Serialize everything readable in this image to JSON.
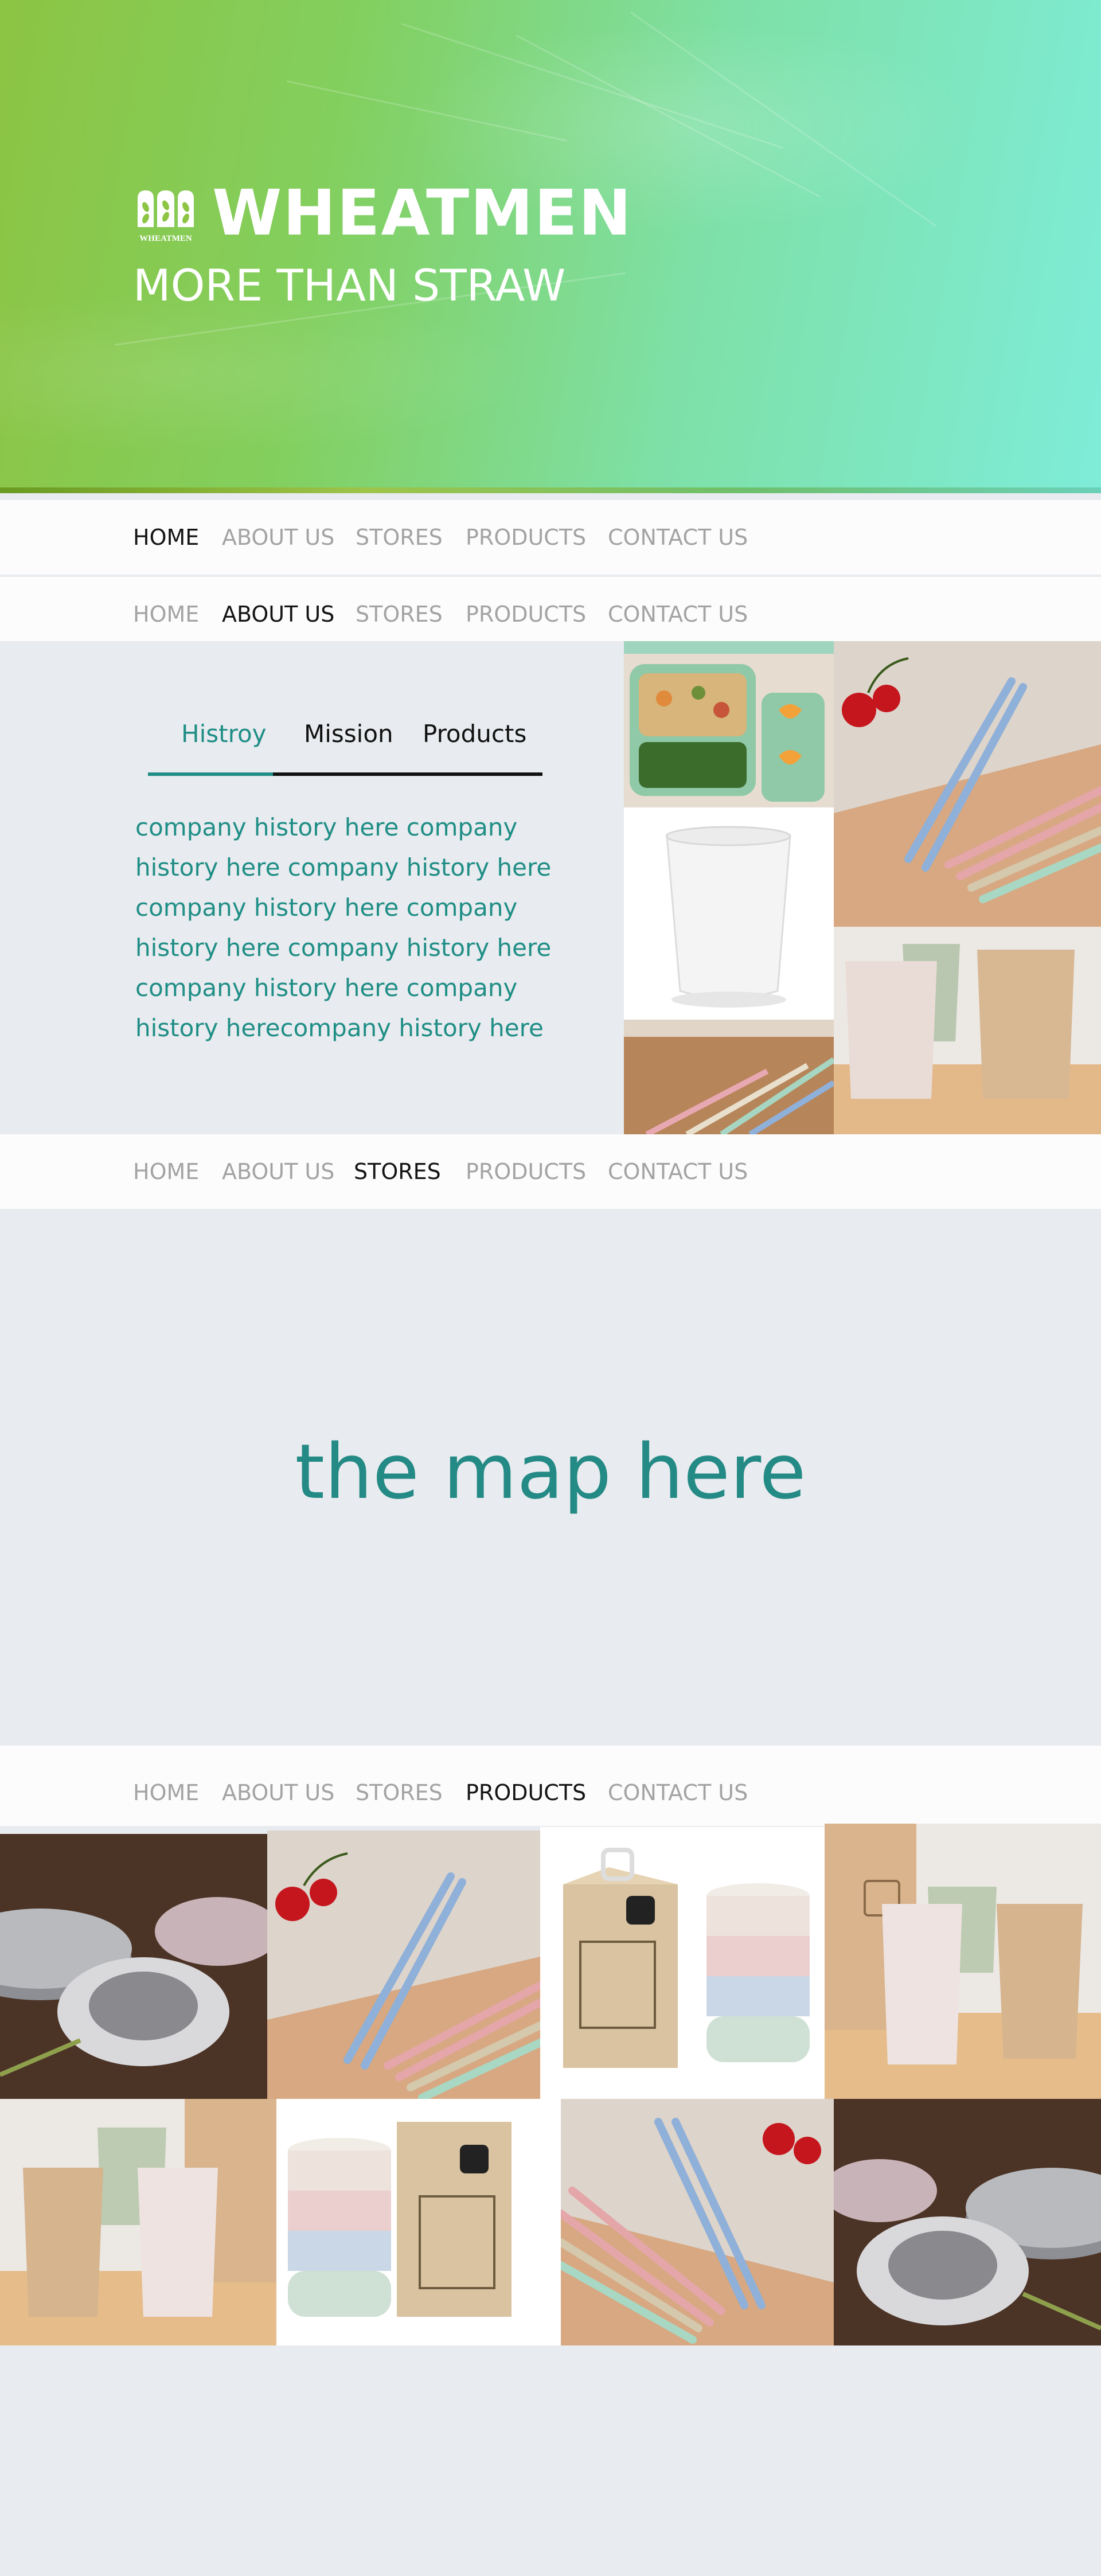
{
  "brand": {
    "name": "WHEATMEN",
    "tagline": "MORE THAN STRAW",
    "logo_caption": "WHEATMEN"
  },
  "nav": {
    "items": [
      "HOME",
      "ABOUT US",
      "STORES",
      "PRODUCTS",
      "CONTACT US"
    ],
    "sections": [
      {
        "active": "HOME"
      },
      {
        "active": "ABOUT US"
      },
      {
        "active": "STORES"
      },
      {
        "active": "PRODUCTS"
      }
    ]
  },
  "about": {
    "tabs": [
      "Histroy",
      "Mission",
      "Products"
    ],
    "active_tab": "Histroy",
    "history_text": "company history here company history here company history here company history here company history here company history here company history here company history herecompany history here"
  },
  "stores": {
    "map_placeholder": "the map here"
  },
  "colors": {
    "accent": "#1f8e86",
    "nav_inactive": "#a3a3a3",
    "nav_active": "#141414",
    "page_bg": "#e8ebef"
  },
  "product_images": [
    "plates",
    "chopsticks",
    "bowls-box",
    "cups-box",
    "cups-box",
    "bowls-box",
    "chopsticks",
    "plates"
  ]
}
